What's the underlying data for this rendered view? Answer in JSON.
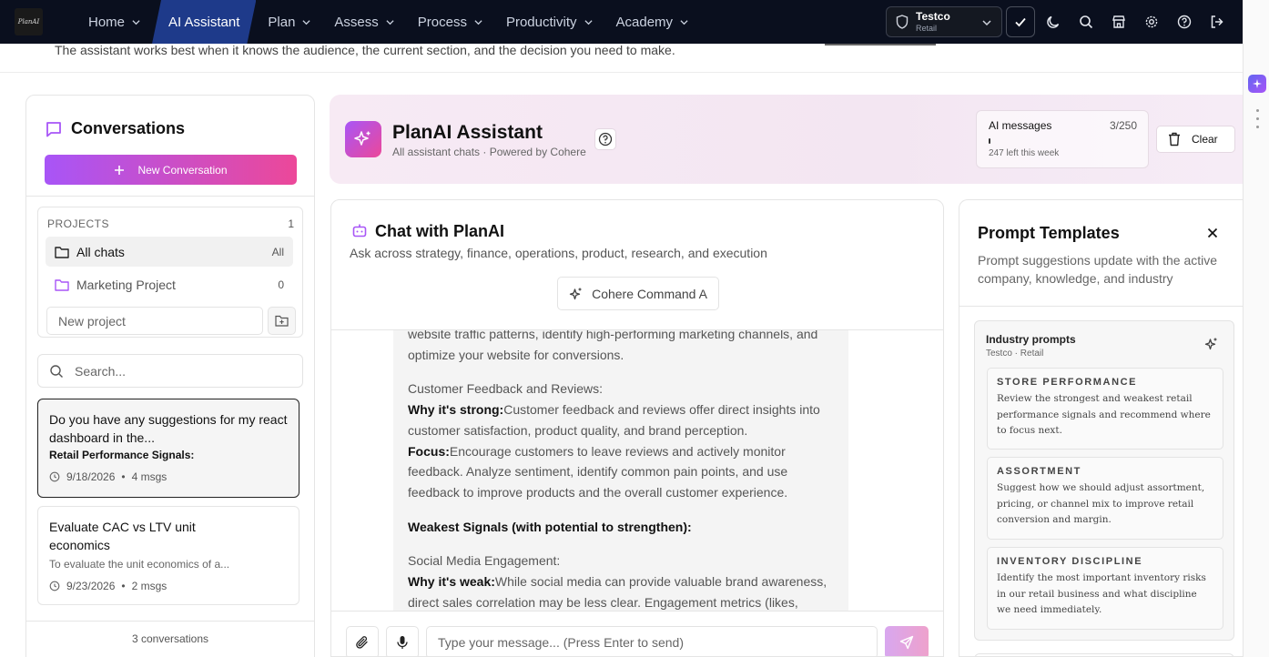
{
  "brand": {
    "logo_text": "PlanAI"
  },
  "nav": {
    "items": [
      {
        "label": "Home",
        "active": false,
        "dropdown": true
      },
      {
        "label": "AI Assistant",
        "active": true,
        "dropdown": false
      },
      {
        "label": "Plan",
        "active": false,
        "dropdown": true
      },
      {
        "label": "Assess",
        "active": false,
        "dropdown": true
      },
      {
        "label": "Process",
        "active": false,
        "dropdown": true
      },
      {
        "label": "Productivity",
        "active": false,
        "dropdown": true
      },
      {
        "label": "Academy",
        "active": false,
        "dropdown": true
      }
    ],
    "company": {
      "name": "Testco",
      "industry": "Retail"
    },
    "icons": [
      "check-icon",
      "moon-icon",
      "search-icon",
      "store-icon",
      "gear-icon",
      "help-icon",
      "logout-icon"
    ]
  },
  "hint": {
    "text": "The assistant works best when it knows the audience, the current section, and the decision you need to make."
  },
  "conversations": {
    "title": "Conversations",
    "new_button": "New Conversation",
    "projects_label": "PROJECTS",
    "projects_count": "1",
    "projects": [
      {
        "name": "All chats",
        "count": "All",
        "selected": true
      },
      {
        "name": "Marketing Project",
        "count": "0",
        "selected": false
      }
    ],
    "new_project_placeholder": "New project",
    "search_placeholder": "Search...",
    "items": [
      {
        "title": "Do you have any suggestions for my react dashboard in the...",
        "subtitle": "Retail Performance Signals:",
        "date": "9/18/2026",
        "msgs": "4 msgs",
        "active": true
      },
      {
        "title": "Evaluate CAC vs LTV unit economics",
        "subtitle": "To evaluate the unit economics of a...",
        "date": "9/23/2026",
        "msgs": "2 msgs",
        "active": false
      }
    ],
    "footer": "3 conversations"
  },
  "assistant": {
    "title": "PlanAI Assistant",
    "subtitle": "All assistant chats · Powered by Cohere",
    "quota": {
      "label": "AI messages",
      "value": "3/250",
      "used_fraction": 0.012,
      "left_text": "247 left this week"
    },
    "clear_label": "Clear"
  },
  "chat": {
    "title": "Chat with PlanAI",
    "subtitle": "Ask across strategy, finance, operations, product, research, and execution",
    "model": "Cohere Command A",
    "message": {
      "p1": "website traffic patterns, identify high-performing marketing channels, and optimize your website for conversions.",
      "h2": "Customer Feedback and Reviews:",
      "why_label": "Why it's strong:",
      "why_text": "Customer feedback and reviews offer direct insights into customer satisfaction, product quality, and brand perception.",
      "focus_label": "Focus:",
      "focus_text": "Encourage customers to leave reviews and actively monitor feedback. Analyze sentiment, identify common pain points, and use feedback to improve products and the overall customer experience.",
      "weak_heading": "Weakest Signals (with potential to strengthen):",
      "h3": "Social Media Engagement:",
      "weak_label": "Why it's weak:",
      "weak_text": "While social media can provide valuable brand awareness, direct sales correlation may be less clear. Engagement metrics (likes,"
    },
    "input_placeholder": "Type your message... (Press Enter to send)"
  },
  "templates": {
    "title": "Prompt Templates",
    "subtitle": "Prompt suggestions update with the active company, knowledge, and industry",
    "industry_title": "Industry prompts",
    "industry_sub": "Testco · Retail",
    "prompts": [
      {
        "heading": "STORE PERFORMANCE",
        "body": "Review the strongest and weakest retail performance signals and recommend where to focus next."
      },
      {
        "heading": "ASSORTMENT",
        "body": "Suggest how we should adjust assortment, pricing, or channel mix to improve retail conversion and margin."
      },
      {
        "heading": "INVENTORY DISCIPLINE",
        "body": "Identify the most important inventory risks in our retail business and what discipline we need immediately."
      }
    ]
  },
  "colors": {
    "nav_bg": "#0a0f1e",
    "nav_active": "#1e3a8a",
    "accent_from": "#a855f7",
    "accent_to": "#ec4899"
  }
}
